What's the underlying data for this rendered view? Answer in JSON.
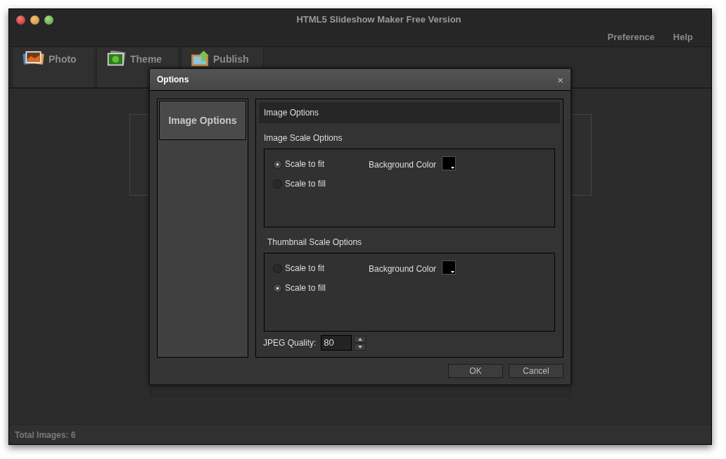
{
  "window": {
    "title": "HTML5 Slideshow Maker Free Version"
  },
  "menu": [
    "Preference",
    "Help"
  ],
  "tabs": [
    {
      "label": "Photo",
      "kind": "photo"
    },
    {
      "label": "Theme",
      "kind": "theme"
    },
    {
      "label": "Publish",
      "kind": "publish"
    }
  ],
  "dialog": {
    "title": "Options",
    "close": "×",
    "sidebar": [
      {
        "label": "Image Options",
        "selected": true
      }
    ],
    "header": "Image Options",
    "groups": [
      {
        "title": "Image Scale Options",
        "options": [
          {
            "label": "Scale to fit",
            "selected": true
          },
          {
            "label": "Scale to fill",
            "selected": false
          }
        ],
        "color_label": "Background Color",
        "color": "#000000"
      },
      {
        "title": "Thumbnail Scale Options",
        "options": [
          {
            "label": "Scale to fit",
            "selected": false
          },
          {
            "label": "Scale to fill",
            "selected": true
          }
        ],
        "color_label": "Background Color",
        "color": "#000000"
      }
    ],
    "quality": {
      "label": "JPEG Quality:",
      "value": "80"
    },
    "buttons": [
      "OK",
      "Cancel"
    ]
  },
  "status_bar": "Total Images: 6"
}
